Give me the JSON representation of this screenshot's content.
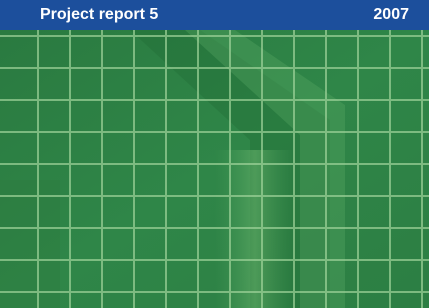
{
  "header": {
    "series_label": "Project report 5",
    "year": "2007"
  },
  "colors": {
    "header_band": "#1c4f9c",
    "cover_green": "#2f8144",
    "grid_line": "#9fd39a"
  }
}
